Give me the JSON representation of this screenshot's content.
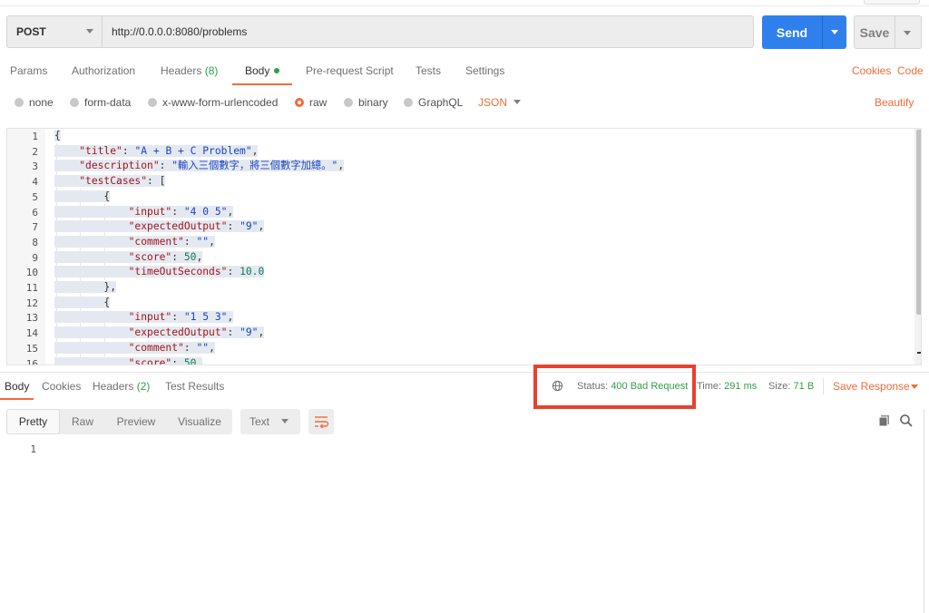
{
  "request": {
    "method": "POST",
    "url": "http://0.0.0.0:8080/problems",
    "send_label": "Send",
    "save_label": "Save"
  },
  "request_tabs": {
    "params": "Params",
    "authorization": "Authorization",
    "headers": "Headers",
    "headers_count": "(8)",
    "body": "Body",
    "pre_request": "Pre-request Script",
    "tests": "Tests",
    "settings": "Settings",
    "cookies": "Cookies",
    "code": "Code"
  },
  "body_types": {
    "none": "none",
    "form_data": "form-data",
    "urlencoded": "x-www-form-urlencoded",
    "raw": "raw",
    "binary": "binary",
    "graphql": "GraphQL",
    "format": "JSON",
    "beautify": "Beautify"
  },
  "editor": {
    "line_numbers": [
      "1",
      "2",
      "3",
      "4",
      "5",
      "6",
      "7",
      "8",
      "9",
      "10",
      "11",
      "12",
      "13",
      "14",
      "15",
      "16"
    ]
  },
  "response_tabs": {
    "body": "Body",
    "cookies": "Cookies",
    "headers": "Headers",
    "headers_count": "(2)",
    "test_results": "Test Results"
  },
  "response_meta": {
    "status_label": "Status:",
    "status_value": "400 Bad Request",
    "time_label": "Time:",
    "time_value": "291 ms",
    "size_label": "Size:",
    "size_value": "71 B",
    "save_response": "Save Response"
  },
  "response_format": {
    "pretty": "Pretty",
    "raw": "Raw",
    "preview": "Preview",
    "visualize": "Visualize",
    "text_type": "Text",
    "line_1": "1"
  },
  "colors": {
    "accent_orange": "#f26b3a",
    "send_blue": "#2f80ed",
    "status_green": "#2e9f4a",
    "highlight_red": "#e8412c"
  }
}
